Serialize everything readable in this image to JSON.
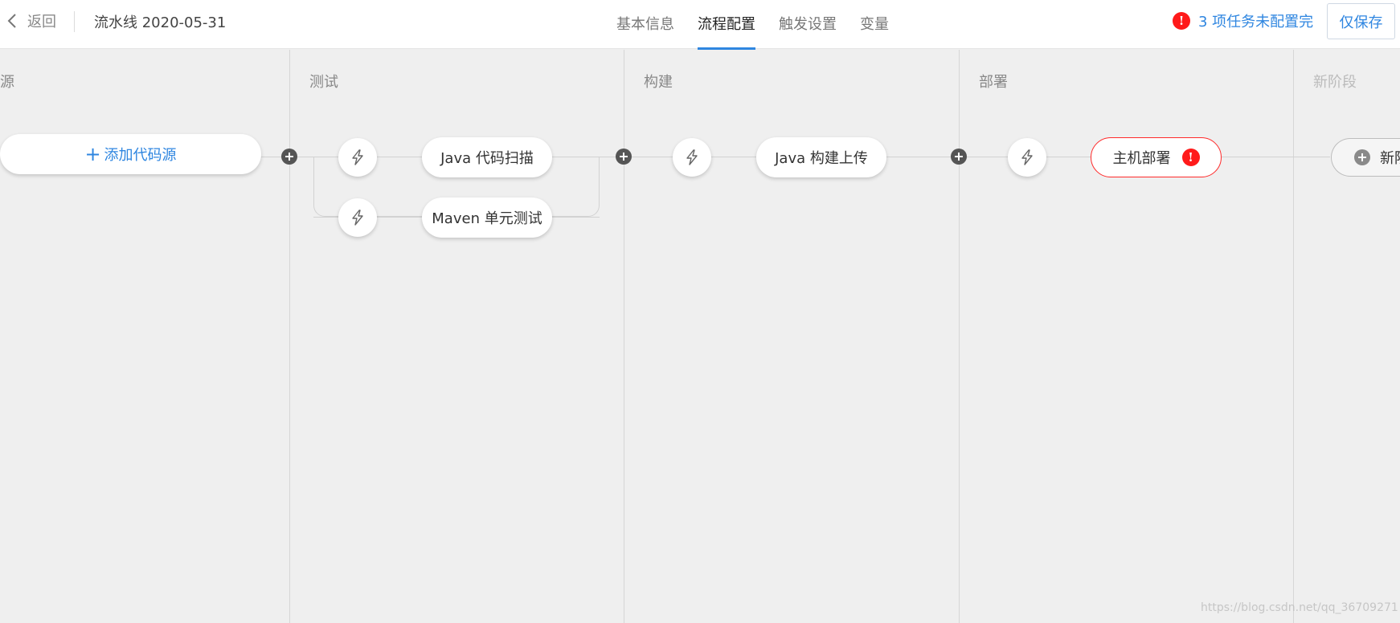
{
  "header": {
    "back_label": "返回",
    "pipeline_title": "流水线 2020-05-31",
    "tabs": [
      {
        "label": "基本信息"
      },
      {
        "label": "流程配置",
        "active": true
      },
      {
        "label": "触发设置"
      },
      {
        "label": "变量"
      }
    ],
    "warning_text": "3 项任务未配置完",
    "warning_icon": "!",
    "save_label": "仅保存"
  },
  "colors": {
    "accent": "#2f86e0",
    "error": "#ff1a1a",
    "canvas_bg": "#efefef"
  },
  "stages": [
    {
      "title": "源",
      "add_source_label": "添加代码源"
    },
    {
      "title": "测试",
      "jobs": [
        {
          "label": "Java 代码扫描"
        },
        {
          "label": "Maven 单元测试"
        }
      ]
    },
    {
      "title": "构建",
      "jobs": [
        {
          "label": "Java 构建上传"
        }
      ]
    },
    {
      "title": "部署",
      "jobs": [
        {
          "label": "主机部署",
          "error": true,
          "error_icon": "!"
        }
      ]
    },
    {
      "title": "新阶段",
      "new_stage_label": "新阶段"
    }
  ],
  "icons": {
    "back": "chevron-left-icon",
    "trigger": "lightning-icon",
    "add": "plus-circle-icon",
    "error": "exclamation-icon"
  },
  "watermark": "https://blog.csdn.net/qq_36709271"
}
